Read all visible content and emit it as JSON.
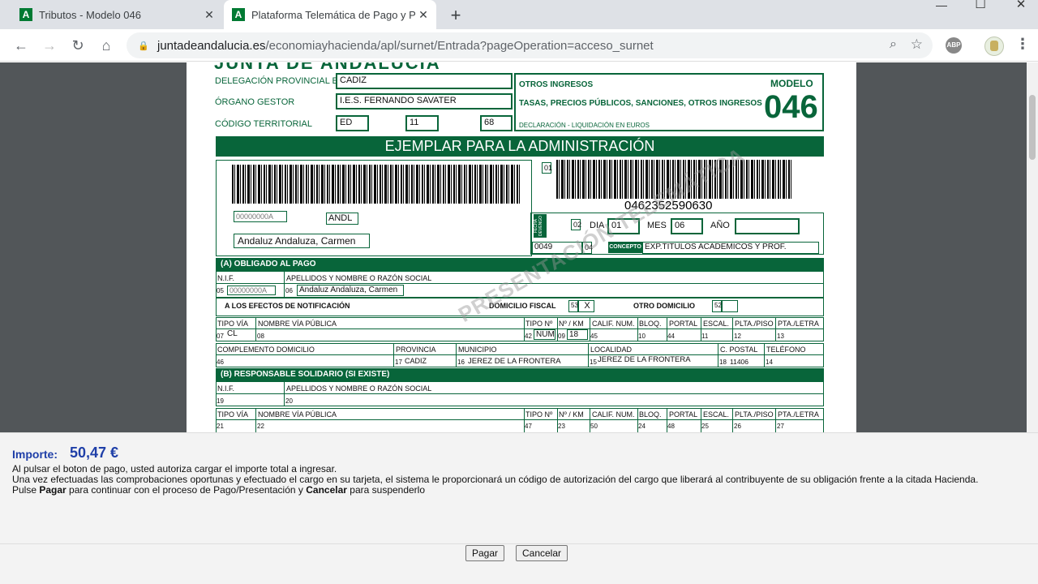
{
  "tabs": [
    {
      "title": "Tributos - Modelo 046",
      "favicon": "A"
    },
    {
      "title": "Plataforma Telemática de Pago y Pre",
      "favicon": "A"
    }
  ],
  "address": {
    "domain": "juntadeandalucia.es",
    "path": "/economiayhacienda/apl/surnet/Entrada?pageOperation=acceso_surnet"
  },
  "icons": {
    "back": "←",
    "forward": "→",
    "reload": "↻",
    "home": "⌂",
    "lock": "🔒",
    "zoom": "⌕",
    "star": "☆",
    "abp": "ABP",
    "menu": "⋮",
    "newtab": "+",
    "minimize": "—",
    "maximize": "☐",
    "close": "✕",
    "tabclose": "✕"
  },
  "form": {
    "header_partial": "JUNTA DE ANDALUCIA",
    "delegacion_label": "DELEGACIÓN PROVINCIAL EN",
    "delegacion_value": "CADIZ",
    "organo_label": "ÓRGANO GESTOR",
    "organo_value": "I.E.S. FERNANDO SAVATER",
    "codigo_label": "CÓDIGO TERRITORIAL",
    "codigo_1": "ED",
    "codigo_2": "11",
    "codigo_3": "68",
    "otros_ingresos": "OTROS INGRESOS",
    "tasas": "TASAS, PRECIOS PÚBLICOS, SANCIONES, OTROS INGRESOS",
    "declaracion": "DECLARACIÓN - LIQUIDACIÓN EN EUROS",
    "modelo_label": "MODELO",
    "modelo_num": "046",
    "ejemplar": "EJEMPLAR PARA LA ADMINISTRACIÓN",
    "nif_small": "00000000A",
    "andl": "ANDL",
    "nombre_box": "Andaluz Andaluza, Carmen",
    "barcode_num": "0462352590630",
    "f01": "01",
    "f02": "02",
    "fecha_label": "FECHA DEVENGO",
    "dia_label": "DIA",
    "dia_value": "01",
    "mes_label": "MES",
    "mes_value": "06",
    "ano_label": "AÑO",
    "ano_value": "",
    "code_0049": "0049",
    "f04": "04",
    "concepto_label": "CONCEPTO",
    "concepto_value": "EXP.TITULOS ACADEMICOS Y PROF.",
    "sec_a": "(A) OBLIGADO AL PAGO",
    "nif_hdr": "N.I.F.",
    "apellidos_hdr": "APELLIDOS Y NOMBRE O RAZÓN SOCIAL",
    "n05": "05",
    "nif_value": "00000000A",
    "n06": "06",
    "name_value": "Andaluz Andaluza, Carmen",
    "notif": "A LOS EFECTOS DE NOTIFICACIÓN",
    "dom_fiscal": "DOMICILIO FISCAL",
    "n53": "53",
    "x_mark": "X",
    "otro_dom": "OTRO DOMICILIO",
    "n52": "52",
    "h_tipovia": "TIPO VÍA",
    "h_nombrevia": "NOMBRE VÍA PÚBLICA",
    "h_tipono": "TIPO Nº",
    "h_nkm": "Nº / KM",
    "h_calif": "CALIF. NUM.",
    "h_bloq": "BLOQ.",
    "h_portal": "PORTAL",
    "h_escal": "ESCAL.",
    "h_plta": "PLTA./PISO",
    "h_pta": "PTA./LETRA",
    "n07": "07",
    "tipovia_value": "CL",
    "n08": "08",
    "n42": "42",
    "tipono_value": "NUM",
    "n09": "09",
    "nkm_value": "18",
    "n45": "45",
    "n10": "10",
    "n44": "44",
    "n11": "11",
    "n12": "12",
    "n13": "13",
    "h_compl": "COMPLEMENTO DOMICILIO",
    "h_prov": "PROVINCIA",
    "h_muni": "MUNICIPIO",
    "h_local": "LOCALIDAD",
    "h_cp": "C. POSTAL",
    "h_tel": "TELÉFONO",
    "n46": "46",
    "n17": "17",
    "prov_value": "CADIZ",
    "n16": "16",
    "muni_value": "JEREZ DE LA FRONTERA",
    "n15": "15",
    "local_value": "JEREZ DE LA FRONTERA",
    "n18": "18",
    "cp_value": "11406",
    "n14": "14",
    "sec_b": "(B) RESPONSABLE SOLIDARIO (SI EXISTE)",
    "n19": "19",
    "n20": "20",
    "n21": "21",
    "n22": "22",
    "n47": "47",
    "n23": "23",
    "n50": "50",
    "n24": "24",
    "n48": "48",
    "n25": "25",
    "n26": "26",
    "n27": "27",
    "watermark": "PRESENTACIÓN TELEMÁTICA"
  },
  "payment": {
    "importe_label": "Importe:",
    "importe_value": "50,47 €",
    "line1": "Al pulsar el boton de pago, usted autoriza cargar el importe total a ingresar.",
    "line2": "Una vez efectuadas las comprobaciones oportunas y efectuado el cargo en su tarjeta, el sistema le proporcionará un código de autorización del cargo que liberará al contribuyente de su obligación frente a la citada Hacienda.",
    "line3_a": "Pulse ",
    "line3_pagar": "Pagar",
    "line3_b": " para continuar con el proceso de Pago/Presentación y ",
    "line3_cancelar": "Cancelar",
    "line3_c": " para suspenderlo",
    "pay_button": "Pagar",
    "cancel_button": "Cancelar"
  }
}
